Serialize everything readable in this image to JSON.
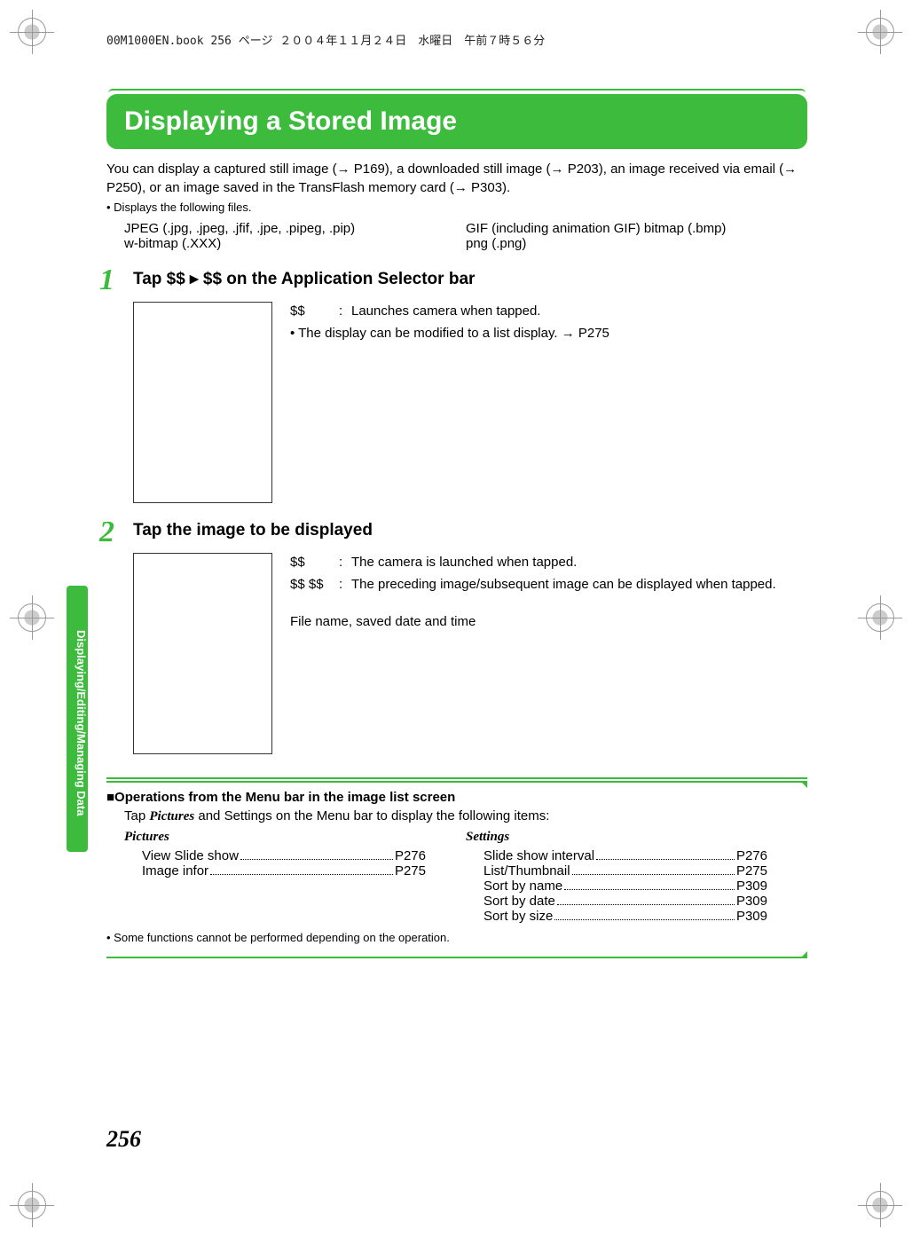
{
  "header_info": "00M1000EN.book  256 ページ  ２００４年１１月２４日　水曜日　午前７時５６分",
  "title": "Displaying a Stored Image",
  "intro": "You can display a captured still image (→ P169), a downloaded still image (→ P203), an image received via email (→ P250), or an image saved in the TransFlash memory card (→ P303).",
  "bullet1": "• Displays the following files.",
  "file_types_left_1": "JPEG (.jpg, .jpeg, .jfif, .jpe, .pipeg, .pip)",
  "file_types_left_2": "w-bitmap (.XXX)",
  "file_types_right_1": "GIF (including animation GIF) bitmap (.bmp)",
  "file_types_right_2": "png (.png)",
  "step1": {
    "num": "1",
    "title": "Tap $$ ▸ $$ on the Application Selector bar",
    "desc1_key": "$$",
    "desc1_val": "Launches camera when tapped.",
    "desc2": "• The display can be modified to a list display. → P275"
  },
  "step2": {
    "num": "2",
    "title": "Tap the image to be displayed",
    "desc1_key": "$$",
    "desc1_val": "The camera is launched when tapped.",
    "desc2_key": "$$ $$",
    "desc2_val": "The preceding image/subsequent image can be displayed when tapped.",
    "note": "File name, saved date and time"
  },
  "ops": {
    "title": "■Operations from the Menu bar in the image list screen",
    "intro_pre": "Tap ",
    "intro_em": "Pictures",
    "intro_post": " and Settings on the Menu bar to display the following items:",
    "left_head": "Pictures",
    "left_items": [
      {
        "label": "View Slide show",
        "page": "P276"
      },
      {
        "label": "Image infor",
        "page": "P275"
      }
    ],
    "right_head": "Settings",
    "right_items": [
      {
        "label": "Slide show interval",
        "page": "P276"
      },
      {
        "label": "List/Thumbnail",
        "page": "P275"
      },
      {
        "label": "Sort by name",
        "page": "P309"
      },
      {
        "label": "Sort by date",
        "page": "P309"
      },
      {
        "label": "Sort by size",
        "page": "P309"
      }
    ],
    "note": "• Some functions cannot be performed depending on the operation."
  },
  "side_tab": "Displaying/Editing/Managing Data",
  "page_num": "256"
}
